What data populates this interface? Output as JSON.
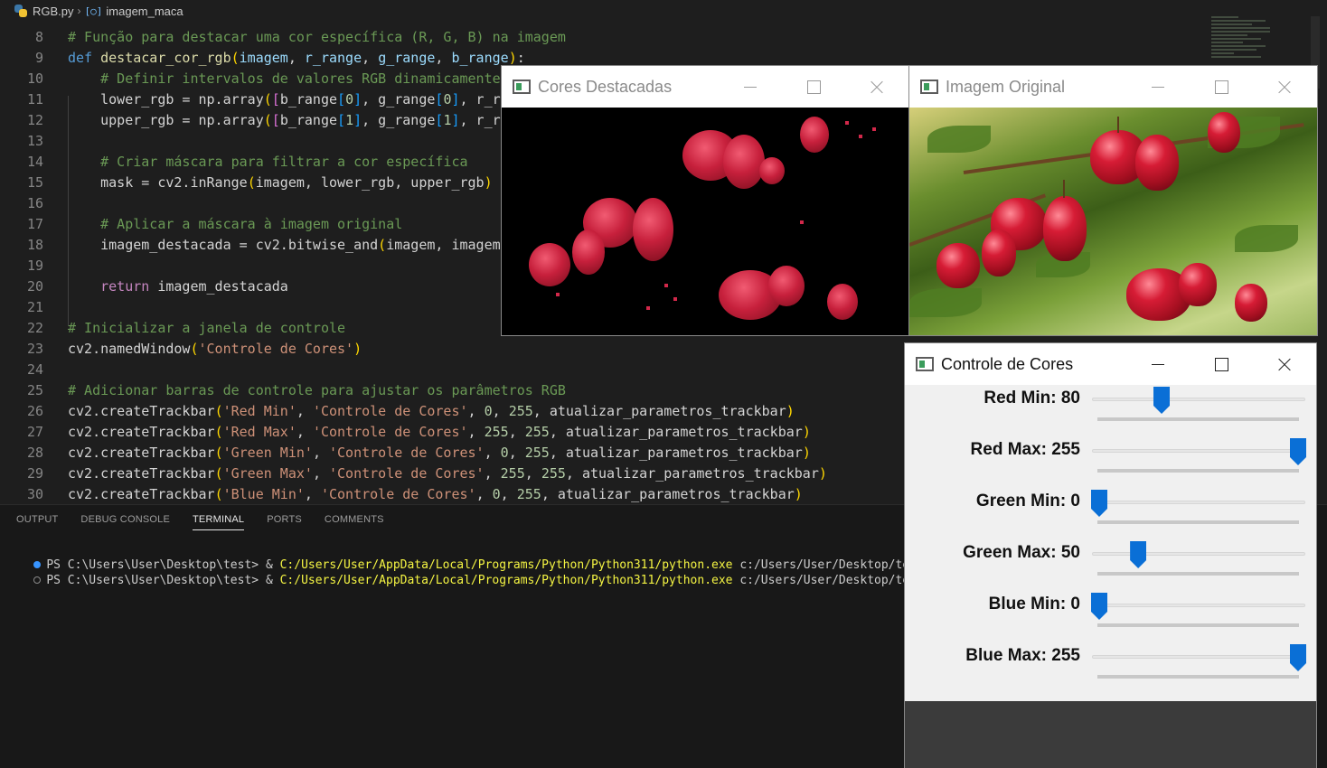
{
  "breadcrumb": {
    "file": "RGB.py",
    "symbol": "imagem_maca"
  },
  "editor": {
    "lines": [
      {
        "n": "8",
        "tokens": [
          [
            "c",
            "# Função para destacar uma cor específica (R, G, B) na imagem"
          ]
        ]
      },
      {
        "n": "9",
        "tokens": [
          [
            "k",
            "def "
          ],
          [
            "f",
            "destacar_cor_rgb"
          ],
          [
            "b",
            "("
          ],
          [
            "p",
            "imagem"
          ],
          [
            "t",
            ", "
          ],
          [
            "p",
            "r_range"
          ],
          [
            "t",
            ", "
          ],
          [
            "p",
            "g_range"
          ],
          [
            "t",
            ", "
          ],
          [
            "p",
            "b_range"
          ],
          [
            "b",
            ")"
          ],
          [
            "t",
            ":"
          ]
        ]
      },
      {
        "n": "10",
        "tokens": [
          [
            "t",
            "    "
          ],
          [
            "c",
            "# Definir intervalos de valores RGB dinamicamente"
          ]
        ]
      },
      {
        "n": "11",
        "tokens": [
          [
            "t",
            "    lower_rgb = np.array"
          ],
          [
            "b",
            "("
          ],
          [
            "b2",
            "["
          ],
          [
            "t",
            "b_range"
          ],
          [
            "b3",
            "["
          ],
          [
            "n",
            "0"
          ],
          [
            "b3",
            "]"
          ],
          [
            "t",
            ", g_range"
          ],
          [
            "b3",
            "["
          ],
          [
            "n",
            "0"
          ],
          [
            "b3",
            "]"
          ],
          [
            "t",
            ", r_range"
          ]
        ]
      },
      {
        "n": "12",
        "tokens": [
          [
            "t",
            "    upper_rgb = np.array"
          ],
          [
            "b",
            "("
          ],
          [
            "b2",
            "["
          ],
          [
            "t",
            "b_range"
          ],
          [
            "b3",
            "["
          ],
          [
            "n",
            "1"
          ],
          [
            "b3",
            "]"
          ],
          [
            "t",
            ", g_range"
          ],
          [
            "b3",
            "["
          ],
          [
            "n",
            "1"
          ],
          [
            "b3",
            "]"
          ],
          [
            "t",
            ", r_range"
          ]
        ]
      },
      {
        "n": "13",
        "tokens": []
      },
      {
        "n": "14",
        "tokens": [
          [
            "t",
            "    "
          ],
          [
            "c",
            "# Criar máscara para filtrar a cor específica"
          ]
        ]
      },
      {
        "n": "15",
        "tokens": [
          [
            "t",
            "    mask = cv2.inRange"
          ],
          [
            "b",
            "("
          ],
          [
            "t",
            "imagem, lower_rgb, upper_rgb"
          ],
          [
            "b",
            ")"
          ]
        ]
      },
      {
        "n": "16",
        "tokens": []
      },
      {
        "n": "17",
        "tokens": [
          [
            "t",
            "    "
          ],
          [
            "c",
            "# Aplicar a máscara à imagem original"
          ]
        ]
      },
      {
        "n": "18",
        "tokens": [
          [
            "t",
            "    imagem_destacada = cv2.bitwise_and"
          ],
          [
            "b",
            "("
          ],
          [
            "t",
            "imagem, imagem, mask=mask"
          ],
          [
            "b",
            ")"
          ]
        ]
      },
      {
        "n": "19",
        "tokens": []
      },
      {
        "n": "20",
        "tokens": [
          [
            "t",
            "    "
          ],
          [
            "x",
            "return"
          ],
          [
            "t",
            " imagem_destacada"
          ]
        ]
      },
      {
        "n": "21",
        "tokens": []
      },
      {
        "n": "22",
        "tokens": [
          [
            "c",
            "# Inicializar a janela de controle"
          ]
        ]
      },
      {
        "n": "23",
        "tokens": [
          [
            "t",
            "cv2.namedWindow"
          ],
          [
            "b",
            "("
          ],
          [
            "s",
            "'Controle de Cores'"
          ],
          [
            "b",
            ")"
          ]
        ]
      },
      {
        "n": "24",
        "tokens": []
      },
      {
        "n": "25",
        "tokens": [
          [
            "c",
            "# Adicionar barras de controle para ajustar os parâmetros RGB"
          ]
        ]
      },
      {
        "n": "26",
        "tokens": [
          [
            "t",
            "cv2.createTrackbar"
          ],
          [
            "b",
            "("
          ],
          [
            "s",
            "'Red Min'"
          ],
          [
            "t",
            ", "
          ],
          [
            "s",
            "'Controle de Cores'"
          ],
          [
            "t",
            ", "
          ],
          [
            "n",
            "0"
          ],
          [
            "t",
            ", "
          ],
          [
            "n",
            "255"
          ],
          [
            "t",
            ", atualizar_parametros_trackbar"
          ],
          [
            "b",
            ")"
          ]
        ]
      },
      {
        "n": "27",
        "tokens": [
          [
            "t",
            "cv2.createTrackbar"
          ],
          [
            "b",
            "("
          ],
          [
            "s",
            "'Red Max'"
          ],
          [
            "t",
            ", "
          ],
          [
            "s",
            "'Controle de Cores'"
          ],
          [
            "t",
            ", "
          ],
          [
            "n",
            "255"
          ],
          [
            "t",
            ", "
          ],
          [
            "n",
            "255"
          ],
          [
            "t",
            ", atualizar_parametros_trackbar"
          ],
          [
            "b",
            ")"
          ]
        ]
      },
      {
        "n": "28",
        "tokens": [
          [
            "t",
            "cv2.createTrackbar"
          ],
          [
            "b",
            "("
          ],
          [
            "s",
            "'Green Min'"
          ],
          [
            "t",
            ", "
          ],
          [
            "s",
            "'Controle de Cores'"
          ],
          [
            "t",
            ", "
          ],
          [
            "n",
            "0"
          ],
          [
            "t",
            ", "
          ],
          [
            "n",
            "255"
          ],
          [
            "t",
            ", atualizar_parametros_trackbar"
          ],
          [
            "b",
            ")"
          ]
        ]
      },
      {
        "n": "29",
        "tokens": [
          [
            "t",
            "cv2.createTrackbar"
          ],
          [
            "b",
            "("
          ],
          [
            "s",
            "'Green Max'"
          ],
          [
            "t",
            ", "
          ],
          [
            "s",
            "'Controle de Cores'"
          ],
          [
            "t",
            ", "
          ],
          [
            "n",
            "255"
          ],
          [
            "t",
            ", "
          ],
          [
            "n",
            "255"
          ],
          [
            "t",
            ", atualizar_parametros_trackbar"
          ],
          [
            "b",
            ")"
          ]
        ]
      },
      {
        "n": "30",
        "tokens": [
          [
            "t",
            "cv2.createTrackbar"
          ],
          [
            "b",
            "("
          ],
          [
            "s",
            "'Blue Min'"
          ],
          [
            "t",
            ", "
          ],
          [
            "s",
            "'Controle de Cores'"
          ],
          [
            "t",
            ", "
          ],
          [
            "n",
            "0"
          ],
          [
            "t",
            ", "
          ],
          [
            "n",
            "255"
          ],
          [
            "t",
            ", atualizar_parametros_trackbar"
          ],
          [
            "b",
            ")"
          ]
        ]
      }
    ]
  },
  "panel": {
    "tabs": [
      "OUTPUT",
      "DEBUG CONSOLE",
      "TERMINAL",
      "PORTS",
      "COMMENTS"
    ],
    "active_tab": "TERMINAL",
    "terminal": [
      {
        "status": "success",
        "prompt": "PS C:\\Users\\User\\Desktop\\test> & ",
        "exe": "C:/Users/User/AppData/Local/Programs/Python/Python311/python.exe",
        "arg": " c:/Users/User/Desktop/tes"
      },
      {
        "status": "running",
        "prompt": "PS C:\\Users\\User\\Desktop\\test> & ",
        "exe": "C:/Users/User/AppData/Local/Programs/Python/Python311/python.exe",
        "arg": " c:/Users/User/Desktop/tes"
      }
    ]
  },
  "windows": {
    "highlighted": {
      "title": "Cores Destacadas"
    },
    "original": {
      "title": "Imagem Original"
    },
    "controls": {
      "title": "Controle de Cores"
    }
  },
  "trackbars": [
    {
      "label": "Red Min: 80",
      "value": 80,
      "max": 255
    },
    {
      "label": "Red Max: 255",
      "value": 255,
      "max": 255
    },
    {
      "label": "Green Min: 0",
      "value": 0,
      "max": 255
    },
    {
      "label": "Green Max: 50",
      "value": 50,
      "max": 255
    },
    {
      "label": "Blue Min: 0",
      "value": 0,
      "max": 255
    },
    {
      "label": "Blue Max: 255",
      "value": 255,
      "max": 255
    }
  ],
  "colors": {
    "editor_bg": "#1e1e1e",
    "panel_bg": "#181818",
    "slider_thumb": "#0a6fd6",
    "terminal_path": "#f5f543"
  }
}
